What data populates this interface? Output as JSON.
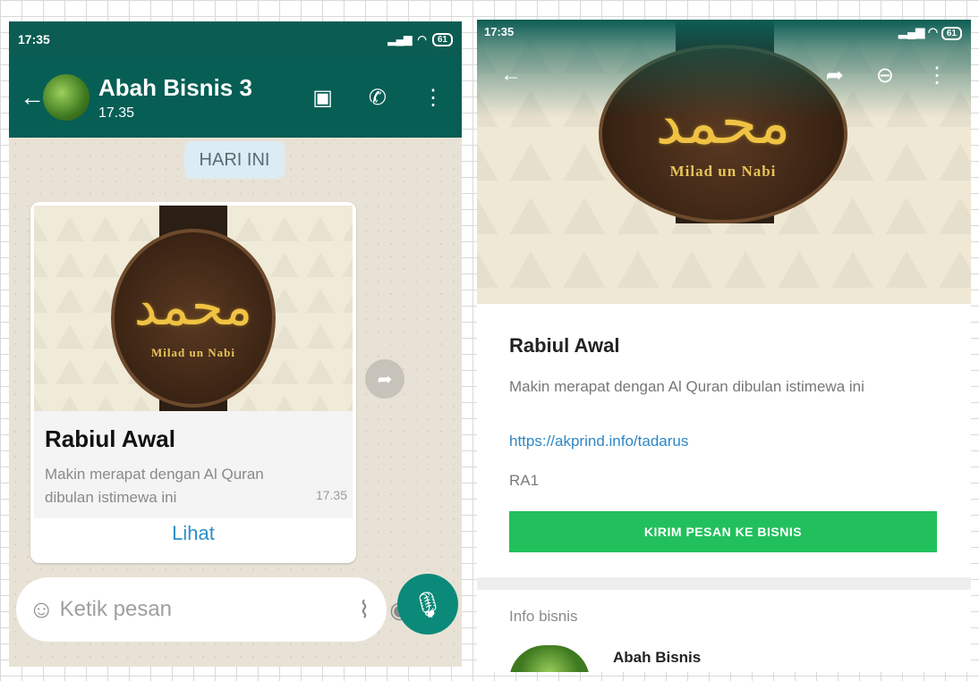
{
  "left": {
    "status": {
      "time": "17:35",
      "battery": "61"
    },
    "header": {
      "title": "Abah Bisnis 3",
      "subtitle": "17.35"
    },
    "date_chip": "HARI INI",
    "message": {
      "image_top_text": "Milad un Nabi",
      "title": "Rabiul Awal",
      "description": "Makin merapat dengan Al Quran dibulan istimewa ini",
      "time": "17.35",
      "action": "Lihat"
    },
    "input": {
      "placeholder": "Ketik pesan"
    }
  },
  "right": {
    "status": {
      "time": "17:35",
      "battery": "61"
    },
    "image_text": "Milad un Nabi",
    "title": "Rabiul Awal",
    "description": "Makin merapat dengan Al Quran dibulan istimewa ini",
    "link": "https://akprind.info/tadarus",
    "code": "RA1",
    "button": "KIRIM PESAN KE BISNIS",
    "info_label": "Info bisnis",
    "business_name": "Abah Bisnis"
  },
  "colors": {
    "header": "#075e54",
    "accent_green": "#22c05c",
    "link_blue": "#2f86c4",
    "mic": "#0b8a7a"
  }
}
